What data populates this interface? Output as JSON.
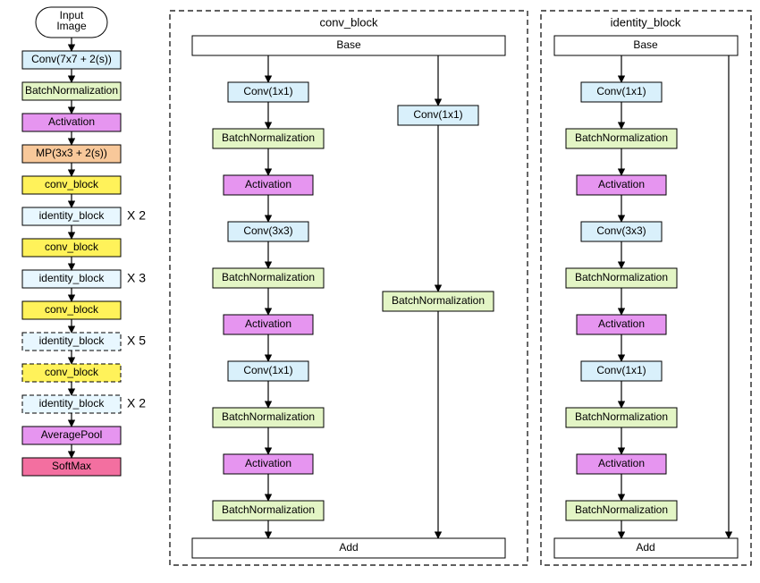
{
  "main": {
    "input": "Input\nImage",
    "n0": "Conv(7x7 + 2(s))",
    "n1": "BatchNormalization",
    "n2": "Activation",
    "n3": "MP(3x3 + 2(s))",
    "cb": "conv_block",
    "ib": "identity_block",
    "avg": "AveragePool",
    "soft": "SoftMax",
    "m2": "X 2",
    "m3": "X 3",
    "m5": "X 5",
    "m2b": "X 2"
  },
  "conv_block": {
    "title": "conv_block",
    "base": "Base",
    "c1": "Conv(1x1)",
    "bn": "BatchNormalization",
    "act": "Activation",
    "c3": "Conv(3x3)",
    "add": "Add"
  },
  "identity_block": {
    "title": "identity_block",
    "base": "Base",
    "c1": "Conv(1x1)",
    "bn": "BatchNormalization",
    "act": "Activation",
    "c3": "Conv(3x3)",
    "add": "Add"
  },
  "colors": {
    "blue": "#d9f0fb",
    "green": "#e3f5c5",
    "magenta": "#e695f0",
    "orange": "#f8c89a",
    "yellow": "#fff25a",
    "pink": "#f36fa0",
    "white": "#ffffff"
  }
}
